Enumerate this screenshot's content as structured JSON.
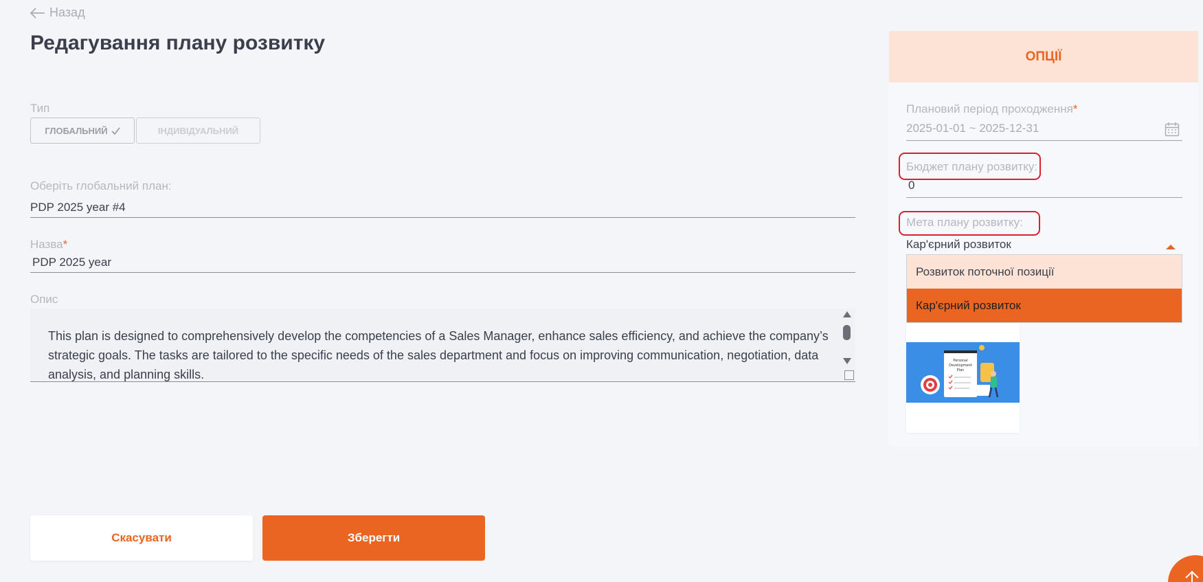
{
  "nav": {
    "back_label": "Назад"
  },
  "page": {
    "title": "Редагування плану розвитку"
  },
  "form": {
    "type_label": "Тип",
    "type_options": [
      "ГЛОБАЛЬНИЙ",
      "ІНДИВІДУАЛЬНИЙ"
    ],
    "type_selected": "ГЛОБАЛЬНИЙ",
    "global_plan_label": "Оберіть глобальний план:",
    "global_plan_value": "PDP 2025 year #4",
    "name_label": "Назва",
    "name_required": "*",
    "name_value": "PDP 2025 year",
    "description_label": "Опис",
    "description_value": "This plan is designed to comprehensively develop the competencies of a Sales Manager, enhance sales efficiency, and achieve the company’s strategic goals. The tasks are tailored to the specific needs of the sales department and focus on improving communication, negotiation, data analysis, and planning skills."
  },
  "actions": {
    "cancel_label": "Скасувати",
    "save_label": "Зберегти"
  },
  "options_panel": {
    "header": "ОПЦІЇ",
    "period_label": "Плановий період проходження",
    "period_required": "*",
    "period_value": "2025-01-01 ~ 2025-12-31",
    "budget_label": "Бюджет плану розвитку:",
    "budget_value": "0",
    "goal_label": "Мета плану розвитку:",
    "goal_value": "Кар'єрний розвиток",
    "goal_options": [
      "Розвиток поточної позиції",
      "Кар'єрний розвиток"
    ],
    "goal_selected": "Кар'єрний розвиток",
    "card_image_text": [
      "Personal",
      "Development",
      "Plan"
    ]
  },
  "colors": {
    "accent": "#ea6422",
    "accent_light": "#fde3d5",
    "highlight": "#d9202f",
    "background": "#f4f5f9"
  },
  "icons": [
    "arrow-left-icon",
    "check-icon",
    "calendar-icon",
    "caret-up-icon",
    "scroll-to-top-icon"
  ]
}
